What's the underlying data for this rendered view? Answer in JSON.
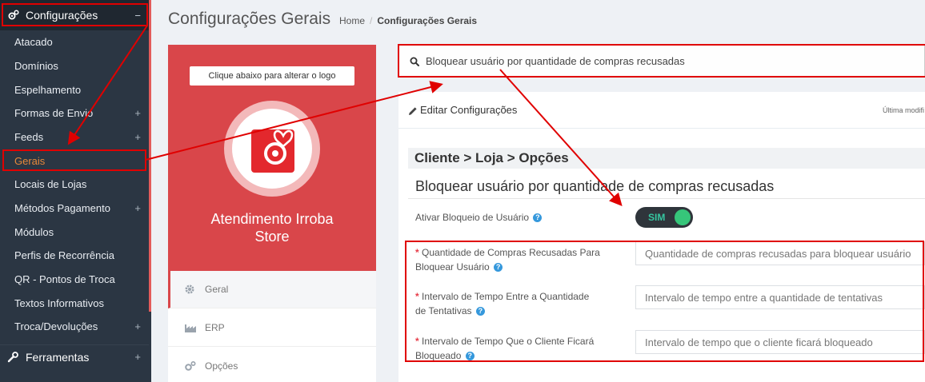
{
  "sidebar": {
    "header": {
      "label": "Configurações",
      "toggle": "−",
      "icon": "gears-icon"
    },
    "items": [
      {
        "label": "Atacado",
        "plus": ""
      },
      {
        "label": "Domínios",
        "plus": ""
      },
      {
        "label": "Espelhamento",
        "plus": ""
      },
      {
        "label": "Formas de Envio",
        "plus": "+"
      },
      {
        "label": "Feeds",
        "plus": "+"
      },
      {
        "label": "Gerais",
        "plus": "",
        "active": true
      },
      {
        "label": "Locais de Lojas",
        "plus": ""
      },
      {
        "label": "Métodos Pagamento",
        "plus": "+"
      },
      {
        "label": "Módulos",
        "plus": ""
      },
      {
        "label": "Perfis de Recorrência",
        "plus": ""
      },
      {
        "label": "QR - Pontos de Troca",
        "plus": ""
      },
      {
        "label": "Textos Informativos",
        "plus": ""
      },
      {
        "label": "Troca/Devoluções",
        "plus": "+"
      }
    ],
    "tools": {
      "label": "Ferramentas",
      "plus": "+",
      "icon": "wrench-icon"
    }
  },
  "header": {
    "title": "Configurações Gerais",
    "breadcrumb": {
      "home": "Home",
      "sep": "/",
      "current": "Configurações Gerais"
    }
  },
  "logo_panel": {
    "button_label": "Clique abaixo para alterar o logo",
    "store_name_line1": "Atendimento Irroba",
    "store_name_line2": "Store"
  },
  "tabs": [
    {
      "label": "Geral",
      "icon": "gear-icon"
    },
    {
      "label": "ERP",
      "icon": "factory-icon"
    },
    {
      "label": "Opções",
      "icon": "gears-icon"
    }
  ],
  "search": {
    "value": "Bloquear usuário por quantidade de compras recusadas",
    "icon": "search-icon"
  },
  "content": {
    "header_label": "Editar Configurações",
    "last_modified": "Última modifi",
    "section_bar": "Cliente > Loja > Opções",
    "section_title": "Bloquear usuário por quantidade de compras recusadas",
    "toggle_label": "Ativar Bloqueio de Usuário",
    "toggle_value": "SIM",
    "fields": [
      {
        "label_line1": "Quantidade de Compras Recusadas Para",
        "label_line2": "Bloquear Usuário",
        "placeholder": "Quantidade de compras recusadas para bloquear usuário"
      },
      {
        "label_line1": "Intervalo de Tempo Entre a Quantidade",
        "label_line2": "de Tentativas",
        "placeholder": "Intervalo de tempo entre a quantidade de tentativas"
      },
      {
        "label_line1": "Intervalo de Tempo Que o Cliente Ficará",
        "label_line2": "Bloqueado",
        "placeholder": "Intervalo de tempo que o cliente ficará bloqueado"
      }
    ],
    "required_mark": "*",
    "help_mark": "?"
  },
  "colors": {
    "annotation": "#e00000",
    "sidebar_bg": "#2b3643",
    "brand_red": "#d9464a",
    "toggle_green": "#36c67a"
  }
}
